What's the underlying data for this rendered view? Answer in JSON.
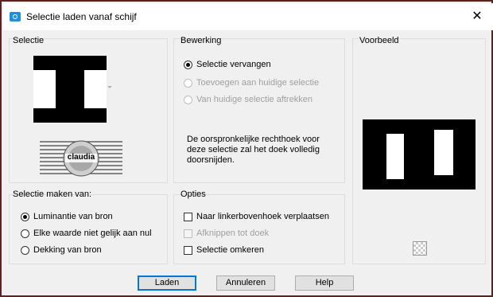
{
  "window": {
    "title": "Selectie laden vanaf schijf",
    "close_icon": "close-icon"
  },
  "selectie": {
    "title": "Selectie",
    "logo_text": "claudia"
  },
  "bewerking": {
    "title": "Bewerking",
    "options": [
      {
        "label": "Selectie vervangen",
        "selected": true,
        "enabled": true
      },
      {
        "label": "Toevoegen aan huidige selectie",
        "selected": false,
        "enabled": false
      },
      {
        "label": "Van huidige selectie aftrekken",
        "selected": false,
        "enabled": false
      }
    ],
    "info": "De oorspronkelijke rechthoek voor deze selectie zal het doek volledig doorsnijden."
  },
  "voorbeeld": {
    "title": "Voorbeeld"
  },
  "selectie_maken": {
    "title": "Selectie maken van:",
    "options": [
      {
        "label": "Luminantie van bron",
        "selected": true
      },
      {
        "label": "Elke waarde niet gelijk aan nul",
        "selected": false
      },
      {
        "label": "Dekking van bron",
        "selected": false
      }
    ]
  },
  "opties": {
    "title": "Opties",
    "checkboxes": [
      {
        "label": "Naar linkerbovenhoek verplaatsen",
        "checked": false,
        "enabled": true
      },
      {
        "label": "Afknippen tot doek",
        "checked": false,
        "enabled": false
      },
      {
        "label": "Selectie omkeren",
        "checked": false,
        "enabled": true
      }
    ]
  },
  "buttons": {
    "load": "Laden",
    "cancel": "Annuleren",
    "help": "Help"
  }
}
